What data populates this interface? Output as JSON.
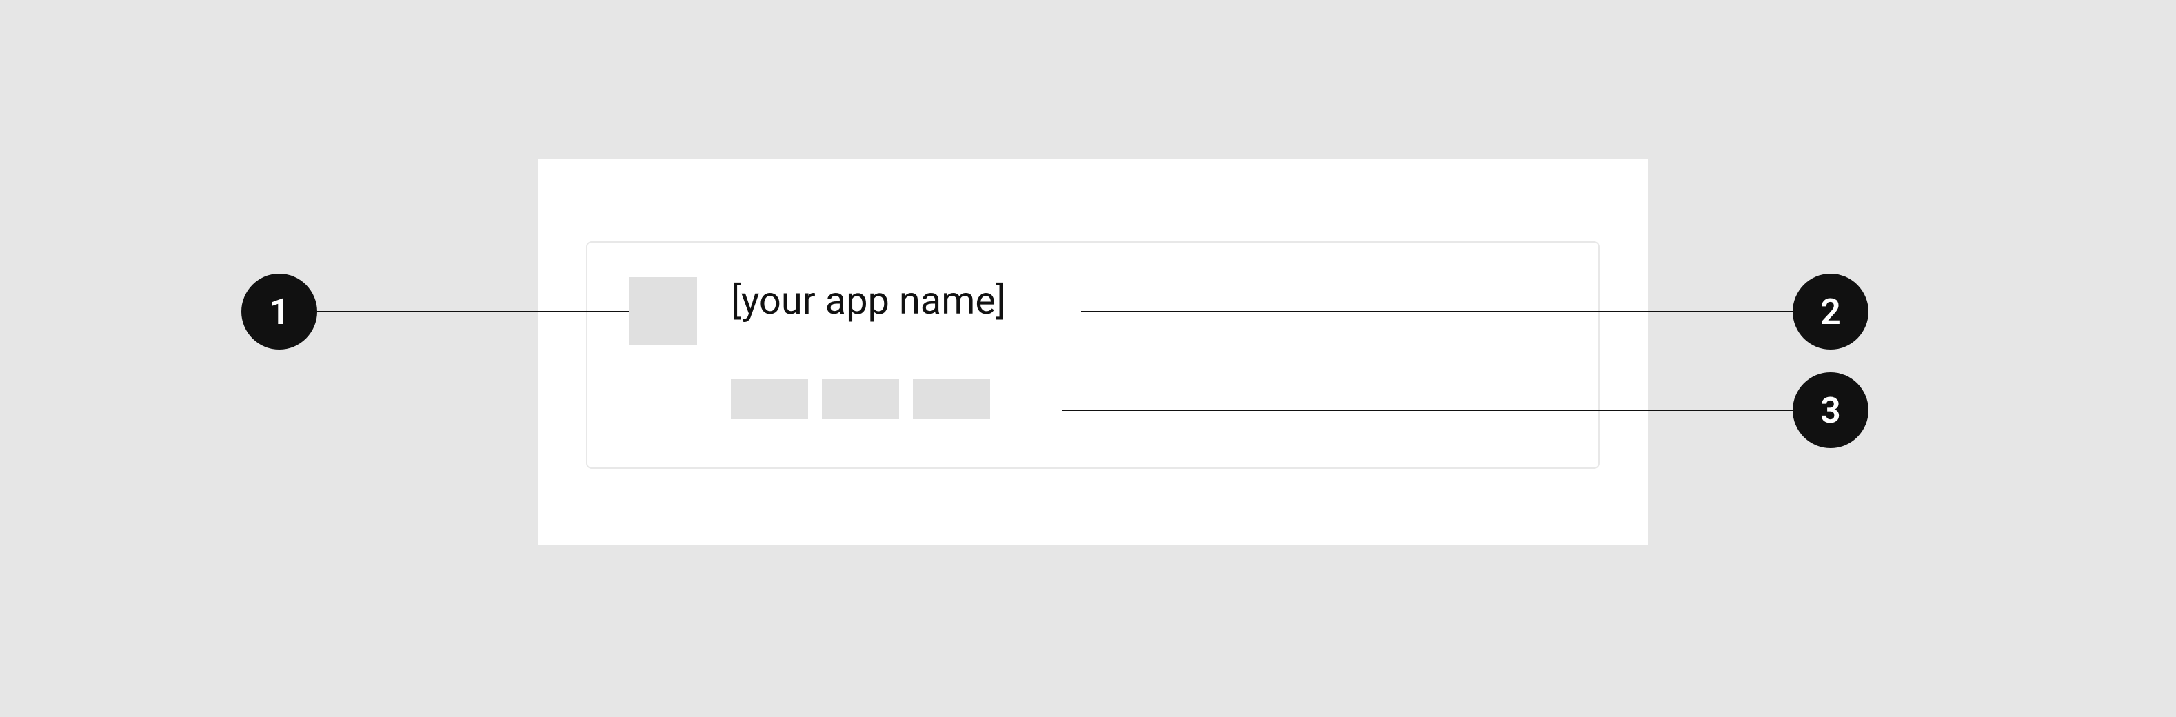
{
  "callouts": {
    "one": "1",
    "two": "2",
    "three": "3"
  },
  "card": {
    "app_name": "[your app name]"
  }
}
